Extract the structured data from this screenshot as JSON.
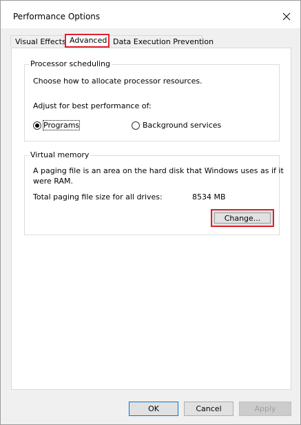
{
  "window": {
    "title": "Performance Options",
    "close_glyph": "✕"
  },
  "tabs": [
    {
      "label": "Visual Effects",
      "selected": false
    },
    {
      "label": "Advanced",
      "selected": true
    },
    {
      "label": "Data Execution Prevention",
      "selected": false
    }
  ],
  "processor_scheduling": {
    "title": "Processor scheduling",
    "description": "Choose how to allocate processor resources.",
    "adjust_label": "Adjust for best performance of:",
    "options": [
      {
        "label": "Programs",
        "checked": true
      },
      {
        "label": "Background services",
        "checked": false
      }
    ]
  },
  "virtual_memory": {
    "title": "Virtual memory",
    "description_line1": "A paging file is an area on the hard disk that Windows uses as if it",
    "description_line2": "were RAM.",
    "total_label": "Total paging file size for all drives:",
    "total_value": "8534 MB",
    "change_label": "Change..."
  },
  "footer": {
    "ok_label": "OK",
    "cancel_label": "Cancel",
    "apply_label": "Apply"
  },
  "colors": {
    "highlight": "#e01f2b",
    "default_button_border": "#0078d7"
  }
}
